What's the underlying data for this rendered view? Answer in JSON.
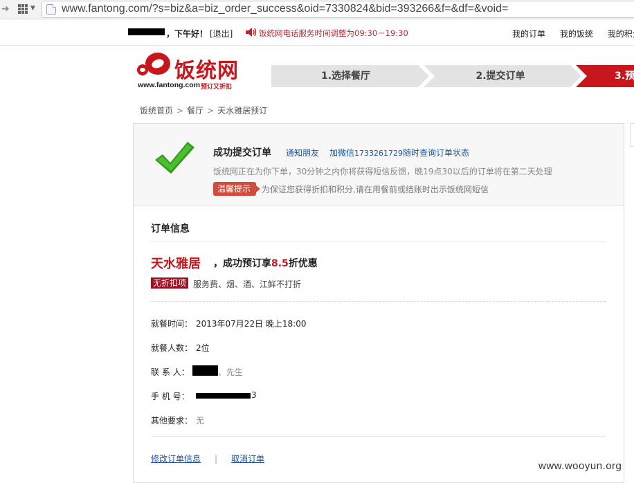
{
  "browser": {
    "url": "www.fantong.com/?s=biz&a=biz_order_success&oid=7330824&bid=393266&f=&df=&void="
  },
  "topbar": {
    "greeting": "，下午好！",
    "logout": "[退出]",
    "notice": "饭统网电话服务时间调整为09:30－19:30",
    "links": [
      "我的订单",
      "我的饭统",
      "我的积分"
    ]
  },
  "logo": {
    "title": "饭统网",
    "domain": "www.fantong.com",
    "slogan": "预订又折扣"
  },
  "steps": [
    {
      "label": "1.选择餐厅",
      "active": false
    },
    {
      "label": "2.提交订单",
      "active": false
    },
    {
      "label": "3.预",
      "active": true
    }
  ],
  "breadcrumb": [
    "饭统首页",
    "餐厅",
    "天水雅居预订"
  ],
  "success": {
    "title": "成功提交订单",
    "notify_link": "通知朋友",
    "wechat_prefix": "加微信",
    "wechat_number": "1733261729",
    "wechat_suffix": "随时查询订单状态",
    "process_text": "饭统网正在为你下单，30分钟之内你将获得短信反馈，晚19点30以后的订单将在第二天处理",
    "tip_badge": "温馨提示",
    "tip_text": "为保证您获得折扣和积分,请在用餐前或结账时出示饭统网短信"
  },
  "order": {
    "heading": "订单信息",
    "restaurant": "天水雅居",
    "discount_prefix": "，成功预订享",
    "discount_rate": "8.5",
    "discount_suffix": "折优惠",
    "no_discount_badge": "无折扣项",
    "no_discount_text": "服务费、烟、酒、江鲜不打折",
    "rows": {
      "time_label": "就餐时间：",
      "time_value": "2013年07月22日 晚上18:00",
      "people_label": "就餐人数：",
      "people_value": "2位",
      "contact_label": "联 系 人：",
      "contact_suffix": "、先生",
      "phone_label": "手 机 号：",
      "phone_suffix": "3",
      "other_label": "其他要求：",
      "other_value": "无"
    },
    "modify_link": "修改订单信息",
    "divider": "|",
    "cancel_link": "取消订单"
  },
  "watermark": "www.wooyun.org",
  "colors": {
    "brand_red": "#c8161d",
    "link_blue": "#1a55a6",
    "check_green": "#2f9a1c"
  }
}
